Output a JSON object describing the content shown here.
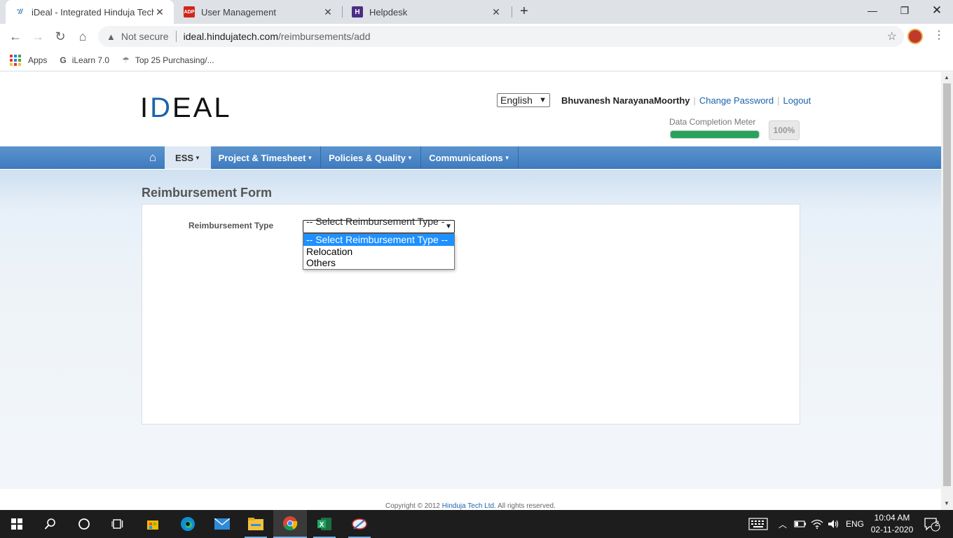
{
  "browser": {
    "tabs": [
      {
        "title": "iDeal - Integrated Hinduja Tech E",
        "favicon": "ideal-favicon",
        "active": true
      },
      {
        "title": "User Management",
        "favicon": "adp-favicon",
        "active": false
      },
      {
        "title": "Helpdesk",
        "favicon": "helpdesk-favicon",
        "active": false
      }
    ],
    "address": {
      "security_label": "Not secure",
      "host": "ideal.hindujatech.com",
      "path": "/reimbursements/add"
    },
    "bookmarks": [
      {
        "label": "Apps",
        "icon": "apps-grid-icon"
      },
      {
        "label": "iLearn 7.0",
        "icon": "google-icon"
      },
      {
        "label": "Top 25 Purchasing/...",
        "icon": "bookmark-site-icon"
      }
    ]
  },
  "header": {
    "logo_text_blue": "D",
    "logo_text_prefix": "I",
    "logo_text_suffix": "EAL",
    "language": "English",
    "user_name": "Bhuvanesh NarayanaMoorthy",
    "change_password": "Change Password",
    "logout": "Logout",
    "meter_label": "Data Completion Meter",
    "meter_value": "100%",
    "meter_fraction": 1.0
  },
  "menu": {
    "items": [
      {
        "label": "ESS",
        "active": true
      },
      {
        "label": "Project & Timesheet",
        "active": false
      },
      {
        "label": "Policies & Quality",
        "active": false
      },
      {
        "label": "Communications",
        "active": false
      }
    ]
  },
  "form": {
    "title": "Reimbursement Form",
    "field_label": "Reimbursement Type",
    "selected": "-- Select Reimbursement Type --",
    "options": [
      "-- Select Reimbursement Type --",
      "Relocation",
      "Others"
    ]
  },
  "footer": {
    "prefix": "Copyright © 2012 ",
    "company": "Hinduja Tech Ltd.",
    "suffix": " All rights reserved."
  },
  "taskbar": {
    "lang": "ENG",
    "time": "10:04 AM",
    "date": "02-11-2020",
    "notifications": "2"
  },
  "colors": {
    "menu_blue": "#4a86c8",
    "meter_green": "#27a35b",
    "link_blue": "#1b64ac",
    "selection_blue": "#1e90ff"
  }
}
